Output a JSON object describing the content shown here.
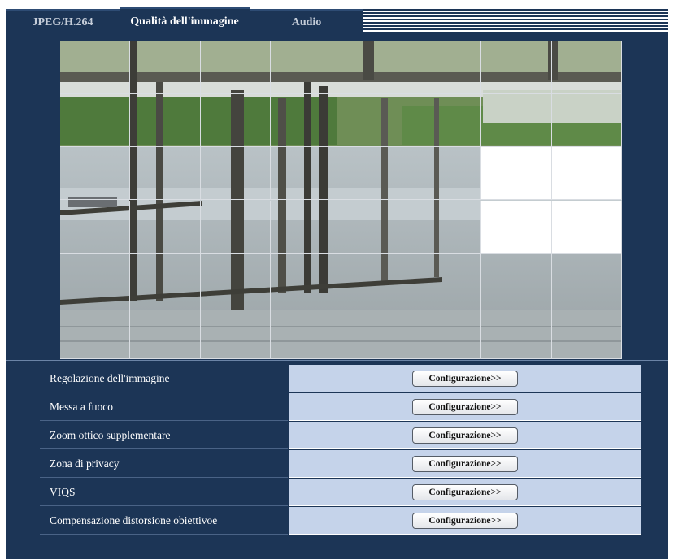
{
  "tabs": [
    {
      "label": "JPEG/H.264",
      "active": false
    },
    {
      "label": "Qualità dell'immagine",
      "active": true
    },
    {
      "label": "Audio",
      "active": false
    }
  ],
  "privacy_grid": {
    "columns": 8,
    "rows": 6,
    "masked_cells": [
      [
        2,
        6
      ],
      [
        2,
        7
      ],
      [
        3,
        6
      ],
      [
        3,
        7
      ]
    ]
  },
  "settings": [
    {
      "label": "Regolazione dell'immagine",
      "button": "Configurazione>>"
    },
    {
      "label": "Messa a fuoco",
      "button": "Configurazione>>"
    },
    {
      "label": "Zoom ottico supplementare",
      "button": "Configurazione>>"
    },
    {
      "label": "Zona di privacy",
      "button": "Configurazione>>"
    },
    {
      "label": "VIQS",
      "button": "Configurazione>>"
    },
    {
      "label": "Compensazione distorsione obiettivoe",
      "button": "Configurazione>>"
    }
  ],
  "colors": {
    "panel_bg": "#1c3556",
    "value_bg": "#c5d3ea",
    "mask": "#ffffff"
  }
}
